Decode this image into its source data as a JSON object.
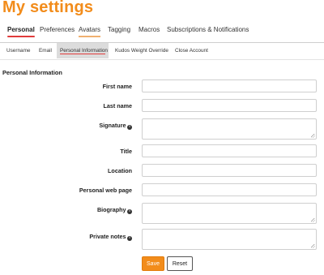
{
  "page": {
    "title": "My settings"
  },
  "main_tabs": [
    {
      "label": "Personal",
      "active": true
    },
    {
      "label": "Preferences"
    },
    {
      "label": "Avatars",
      "highlighted": true
    },
    {
      "label": "Tagging"
    },
    {
      "label": "Macros"
    },
    {
      "label": "Subscriptions & Notifications"
    }
  ],
  "sub_tabs": [
    {
      "label": "Username"
    },
    {
      "label": "Email"
    },
    {
      "label": "Personal Information",
      "active": true
    },
    {
      "label": "Kudos Weight Override"
    },
    {
      "label": "Close Account"
    }
  ],
  "section": {
    "title": "Personal Information"
  },
  "fields": [
    {
      "label": "First name",
      "value": "",
      "type": "text"
    },
    {
      "label": "Last name",
      "value": "",
      "type": "text"
    },
    {
      "label": "Signature",
      "value": "",
      "type": "textarea",
      "info": true
    },
    {
      "label": "Title",
      "value": "",
      "type": "text"
    },
    {
      "label": "Location",
      "value": "",
      "type": "text"
    },
    {
      "label": "Personal web page",
      "value": "",
      "type": "text"
    },
    {
      "label": "Biography",
      "value": "",
      "type": "textarea",
      "info": true
    },
    {
      "label": "Private notes",
      "value": "",
      "type": "textarea",
      "info": true
    }
  ],
  "info_icon_glyph": "i",
  "buttons": {
    "save": "Save",
    "reset": "Reset"
  },
  "colors": {
    "accent": "#f28c1b",
    "active_underline": "#e03b3b"
  }
}
